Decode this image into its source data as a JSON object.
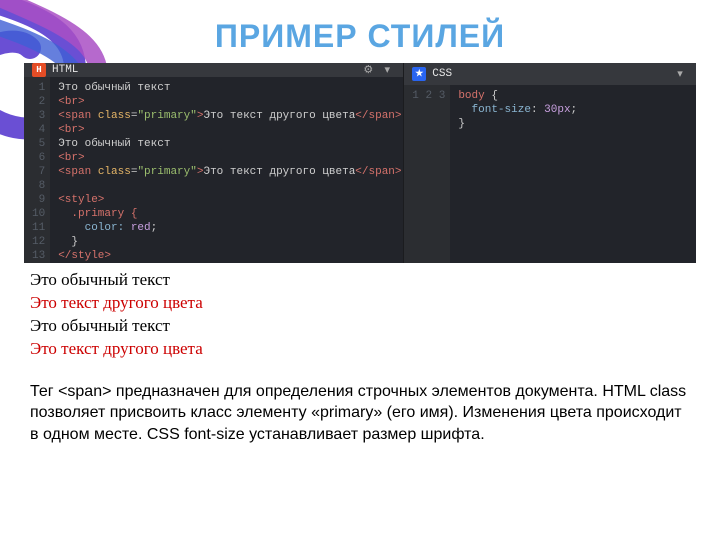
{
  "title": "ПРИМЕР СТИЛЕЙ",
  "panes": {
    "html": {
      "label": "HTML"
    },
    "css": {
      "label": "CSS"
    }
  },
  "html_lines": [
    "1",
    "2",
    "3",
    "4",
    "5",
    "6",
    "7",
    "8",
    "9",
    "10",
    "11",
    "12",
    "13"
  ],
  "css_lines": [
    "1",
    "2",
    "3"
  ],
  "html_code": {
    "l1": "Это обычный текст",
    "l2_tag_open": "<",
    "l2_tag": "br",
    "l2_tag_close": ">",
    "l3_open": "<",
    "l3_tag": "span",
    "l3_attr": " class",
    "l3_eq": "=",
    "l3_val": "\"primary\"",
    "l3_gt": ">",
    "l3_text": "Это текст другого цвета",
    "l3_close_open": "</",
    "l3_close_tag": "span",
    "l3_close_end": ">",
    "l4_tag": "<br>",
    "l5": "Это обычный текст",
    "l6_tag": "<br>",
    "l7_repeat": "<span class=\"primary\">Это текст другого цвета</span>",
    "l9_open": "<style>",
    "l10_sel": "  .primary {",
    "l11_prop": "    color: ",
    "l11_val": "red",
    "l11_end": ";",
    "l12_close": "  }",
    "l13_close": "</style>"
  },
  "css_code": {
    "l1_sel": "body",
    "l1_brace": " {",
    "l2_prop": "  font-size",
    "l2_colon": ": ",
    "l2_val": "30px",
    "l2_end": ";",
    "l3": "}"
  },
  "output": {
    "l1": "Это обычный текст",
    "l2": "Это текст другого цвета",
    "l3": "Это обычный текст",
    "l4": "Это текст другого цвета"
  },
  "caption": {
    "p1a": "Тег ",
    "p1b": "<span>",
    "p1c": " предназначен для определения строчных элементов документа. HTML class позволяет присвоить класс элементу «primary» (его имя). Изменения цвета происходит в одном месте. CSS font-size устанавливает размер шрифта."
  }
}
